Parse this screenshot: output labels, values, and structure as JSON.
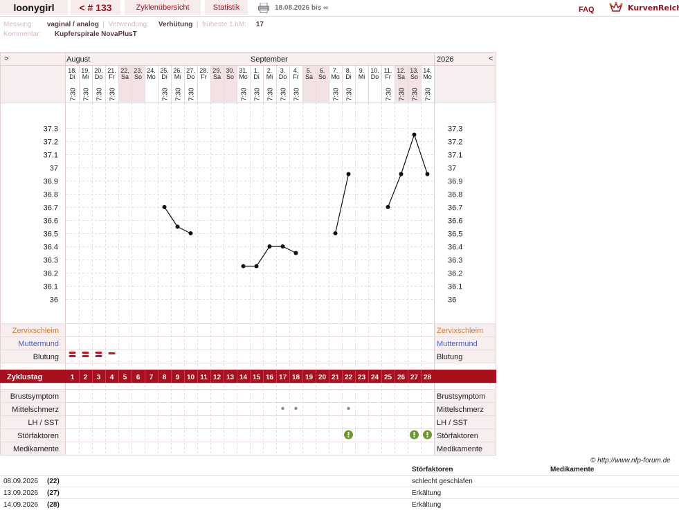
{
  "header": {
    "user": "loonygirl",
    "cycle_nav": "< # 133",
    "overview_tab": "Zyklenübersicht",
    "stats_tab": "Statistik",
    "print_icon": "printer-icon",
    "date_range": "18.08.2026 bis ∞",
    "faq": "FAQ",
    "brand": "KurvenReich",
    "brand_icon": "crown-icon"
  },
  "meta": {
    "measure_label": "Messung:",
    "measure_value": "vaginal / analog",
    "use_label": "Verwendung:",
    "use_value": "Verhütung",
    "earliest_label": "früheste 1.hM:",
    "earliest_value": "17",
    "comment_label": "Kommentar:",
    "comment_value": "Kupferspirale NovaPlusT"
  },
  "chart_data": {
    "type": "line",
    "months": {
      "left": "August",
      "center": "September",
      "year": "2026"
    },
    "nav": {
      "prev": ">",
      "next": "<"
    },
    "days": [
      {
        "date": "18.",
        "wd": "Di",
        "time": "7:30",
        "we": false
      },
      {
        "date": "19.",
        "wd": "Mi",
        "time": "7:30",
        "we": false
      },
      {
        "date": "20.",
        "wd": "Do",
        "time": "7:30",
        "we": false
      },
      {
        "date": "21.",
        "wd": "Fr",
        "time": "7:30",
        "we": false
      },
      {
        "date": "22.",
        "wd": "Sa",
        "time": "",
        "we": true
      },
      {
        "date": "23.",
        "wd": "So",
        "time": "",
        "we": true
      },
      {
        "date": "24.",
        "wd": "Mo",
        "time": "",
        "we": false
      },
      {
        "date": "25.",
        "wd": "Di",
        "time": "7:30",
        "we": false
      },
      {
        "date": "26.",
        "wd": "Mi",
        "time": "7:30",
        "we": false
      },
      {
        "date": "27.",
        "wd": "Do",
        "time": "7:30",
        "we": false
      },
      {
        "date": "28.",
        "wd": "Fr",
        "time": "",
        "we": false
      },
      {
        "date": "29.",
        "wd": "Sa",
        "time": "",
        "we": true
      },
      {
        "date": "30.",
        "wd": "So",
        "time": "",
        "we": true
      },
      {
        "date": "31.",
        "wd": "Mo",
        "time": "7:30",
        "we": false
      },
      {
        "date": "1.",
        "wd": "Di",
        "time": "7:30",
        "we": false
      },
      {
        "date": "2.",
        "wd": "Mi",
        "time": "7:30",
        "we": false
      },
      {
        "date": "3.",
        "wd": "Do",
        "time": "7:30",
        "we": false
      },
      {
        "date": "4.",
        "wd": "Fr",
        "time": "7:30",
        "we": false
      },
      {
        "date": "5.",
        "wd": "Sa",
        "time": "",
        "we": true
      },
      {
        "date": "6.",
        "wd": "So",
        "time": "",
        "we": true
      },
      {
        "date": "7.",
        "wd": "Mo",
        "time": "7:30",
        "we": false
      },
      {
        "date": "8.",
        "wd": "Di",
        "time": "7:30",
        "we": false
      },
      {
        "date": "9.",
        "wd": "Mi",
        "time": "",
        "we": false
      },
      {
        "date": "10.",
        "wd": "Do",
        "time": "",
        "we": false
      },
      {
        "date": "11.",
        "wd": "Fr",
        "time": "7:30",
        "we": false
      },
      {
        "date": "12.",
        "wd": "Sa",
        "time": "7:30",
        "we": true
      },
      {
        "date": "13.",
        "wd": "So",
        "time": "7:30",
        "we": true
      },
      {
        "date": "14.",
        "wd": "Mo",
        "time": "7:30",
        "we": false
      }
    ],
    "y_ticks": [
      "37.3",
      "37.2",
      "37.1",
      "37",
      "36.9",
      "36.8",
      "36.7",
      "36.6",
      "36.5",
      "36.4",
      "36.3",
      "36.2",
      "36.1",
      "36"
    ],
    "ylim": [
      36.0,
      37.3
    ],
    "temperatures": [
      null,
      null,
      null,
      null,
      null,
      null,
      null,
      36.7,
      36.55,
      36.5,
      null,
      null,
      null,
      36.25,
      36.25,
      36.4,
      36.4,
      36.35,
      null,
      null,
      36.5,
      36.95,
      null,
      null,
      36.7,
      36.95,
      37.25,
      36.95
    ],
    "segments": [
      [
        7,
        9
      ],
      [
        13,
        17
      ],
      [
        20,
        21
      ],
      [
        24,
        27
      ]
    ],
    "row_labels": {
      "cervical": "Zervixschleim",
      "cervix": "Muttermund",
      "bleeding": "Blutung",
      "cycle_day": "Zyklustag",
      "breast": "Brustsymptom",
      "midpain": "Mittelschmerz",
      "lh": "LH / SST",
      "disturb": "Störfaktoren",
      "meds": "Medikamente"
    },
    "colors": {
      "cervical": "#e07a20",
      "cervix": "#4a5fc8",
      "bar": "#a8101e",
      "bleeding": "#cc1020",
      "alert": "#6a9a2c"
    },
    "bleeding": [
      2,
      2,
      2,
      1
    ],
    "cycle_days": [
      "1",
      "2",
      "3",
      "4",
      "5",
      "6",
      "7",
      "8",
      "9",
      "10",
      "11",
      "12",
      "13",
      "14",
      "15",
      "16",
      "17",
      "18",
      "19",
      "20",
      "21",
      "22",
      "23",
      "24",
      "25",
      "26",
      "27",
      "28"
    ],
    "midpain_dots": [
      16,
      17,
      21
    ],
    "disturb_icons": [
      21,
      26,
      27
    ]
  },
  "credit": "© http://www.nfp-forum.de",
  "notes_table": {
    "col_disturb": "Störfaktoren",
    "col_meds": "Medikamente",
    "rows": [
      {
        "date": "08.09.2026",
        "day": "(22)",
        "disturb": "schlecht geschlafen",
        "meds": ""
      },
      {
        "date": "13.09.2026",
        "day": "(27)",
        "disturb": "Erkältung",
        "meds": ""
      },
      {
        "date": "14.09.2026",
        "day": "(28)",
        "disturb": "Erkältung",
        "meds": ""
      }
    ]
  }
}
